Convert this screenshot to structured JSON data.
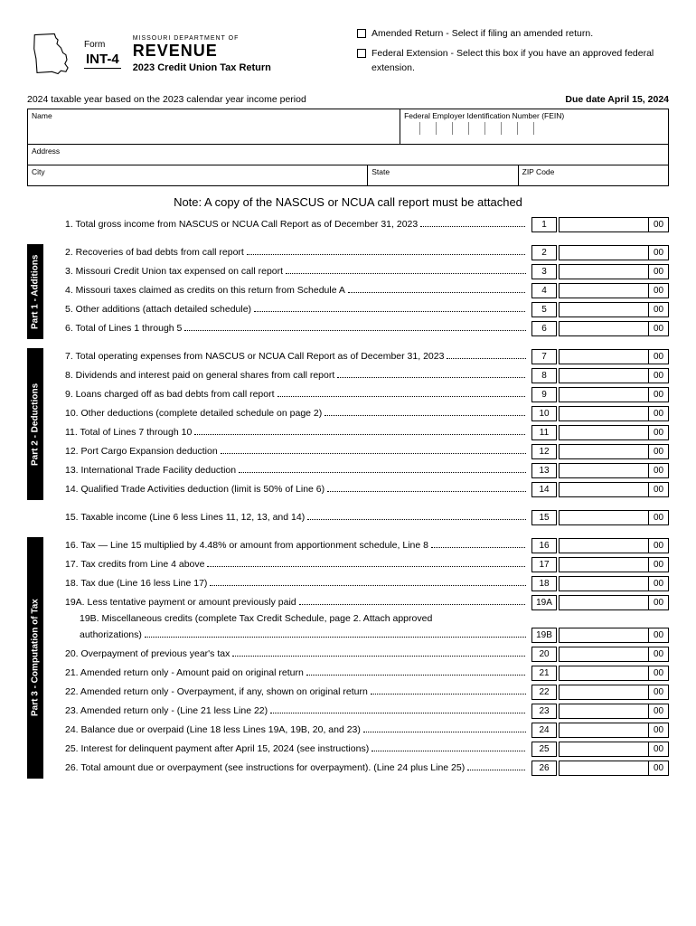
{
  "header": {
    "form_word": "Form",
    "form_code": "INT-4",
    "dept": "MISSOURI DEPARTMENT OF",
    "revenue": "REVENUE",
    "title": "2023 Credit Union Tax Return",
    "amended": "Amended Return - Select if filing an amended return.",
    "extension": "Federal Extension - Select this box if you have an approved federal extension."
  },
  "meta": {
    "year_basis": "2024 taxable year based on the 2023 calendar year income period",
    "due": "Due date April 15, 2024"
  },
  "fields": {
    "name": "Name",
    "fein": "Federal Employer Identification Number (FEIN)",
    "address": "Address",
    "city": "City",
    "state": "State",
    "zip": "ZIP Code"
  },
  "note": "Note: A copy of the NASCUS or NCUA call report must be attached",
  "tabs": {
    "p1": "Part 1 - Additions",
    "p2": "Part 2 - Deductions",
    "p3": "Part 3 - Computation of Tax"
  },
  "l": {
    "1": "1.  Total gross income from NASCUS or NCUA Call Report as of December 31, 2023",
    "2": "2.  Recoveries of bad debts from call report",
    "3": "3.  Missouri Credit Union tax expensed on call report",
    "4": "4.  Missouri taxes claimed as credits on this return from Schedule A",
    "5": "5.  Other additions (attach detailed schedule)",
    "6": "6.  Total of Lines 1 through 5",
    "7": "7.  Total operating expenses from NASCUS or NCUA Call Report as of December 31, 2023",
    "8": "8.  Dividends and interest paid on general shares from call report",
    "9": "9.  Loans charged off as bad debts from call report",
    "10": "10.  Other deductions (complete detailed schedule on page 2)",
    "11": "11.  Total of Lines 7 through 10",
    "12": "12.  Port Cargo Expansion deduction",
    "13": "13.  International Trade Facility deduction",
    "14": "14.  Qualified Trade Activities deduction (limit is 50% of Line 6)",
    "15": "15.  Taxable income (Line 6 less Lines 11, 12, 13, and 14)",
    "16": "16.  Tax — Line 15 multiplied by 4.48% or amount from apportionment schedule, Line 8",
    "17": "17.  Tax credits from Line 4 above",
    "18": "18.  Tax due (Line 16 less Line 17)",
    "19A": "19A.  Less tentative payment or amount previously paid ",
    "19B": "19B.  Miscellaneous credits (complete Tax Credit Schedule, page 2. Attach approved",
    "19Bc": "authorizations) ",
    "20": "20.  Overpayment of previous year's tax",
    "21": "21.  Amended return only - Amount paid on original return",
    "22": "22.  Amended return only - Overpayment, if any, shown on original return",
    "23": "23.  Amended return only - (Line 21 less Line 22) ",
    "24": "24.  Balance due or overpaid (Line 18 less Lines 19A, 19B, 20, and 23) ",
    "25": "25.  Interest for delinquent payment after April 15, 2024 (see instructions)",
    "26": "26.  Total amount due or overpayment (see instructions for overpayment). (Line 24 plus Line 25)"
  },
  "n": {
    "1": "1",
    "2": "2",
    "3": "3",
    "4": "4",
    "5": "5",
    "6": "6",
    "7": "7",
    "8": "8",
    "9": "9",
    "10": "10",
    "11": "11",
    "12": "12",
    "13": "13",
    "14": "14",
    "15": "15",
    "16": "16",
    "17": "17",
    "18": "18",
    "19A": "19A",
    "19B": "19B",
    "20": "20",
    "21": "21",
    "22": "22",
    "23": "23",
    "24": "24",
    "25": "25",
    "26": "26"
  },
  "cents": "00"
}
